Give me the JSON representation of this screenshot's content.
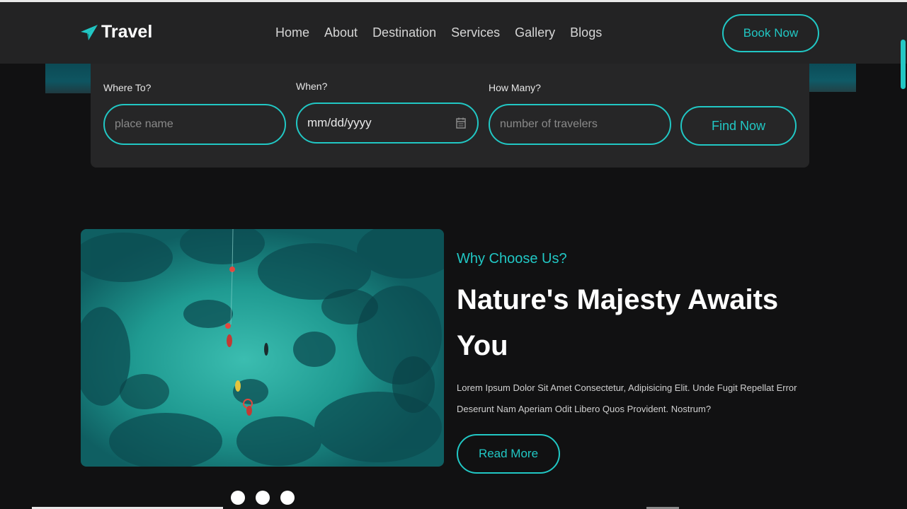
{
  "brand": {
    "name": "Travel",
    "logo_icon": "paper-plane-icon",
    "accent_color": "#21c7c4"
  },
  "nav": {
    "items": [
      "Home",
      "About",
      "Destination",
      "Services",
      "Gallery",
      "Blogs"
    ],
    "cta_label": "Book Now"
  },
  "search": {
    "where": {
      "label": "Where To?",
      "placeholder": "place name"
    },
    "when": {
      "label": "When?",
      "value": "mm/dd/yyyy",
      "icon": "calendar-icon"
    },
    "how_many": {
      "label": "How Many?",
      "placeholder": "number of travelers"
    },
    "submit_label": "Find Now"
  },
  "about": {
    "image_alt": "aerial-ocean-divers-image",
    "eyebrow": "Why Choose Us?",
    "headline": "Nature's Majesty Awaits You",
    "body": "Lorem Ipsum Dolor Sit Amet Consectetur, Adipisicing Elit. Unde Fugit Repellat Error Deserunt Nam Aperiam Odit Libero Quos Provident. Nostrum?",
    "cta_label": "Read More"
  },
  "slider": {
    "dot_count": 3
  }
}
